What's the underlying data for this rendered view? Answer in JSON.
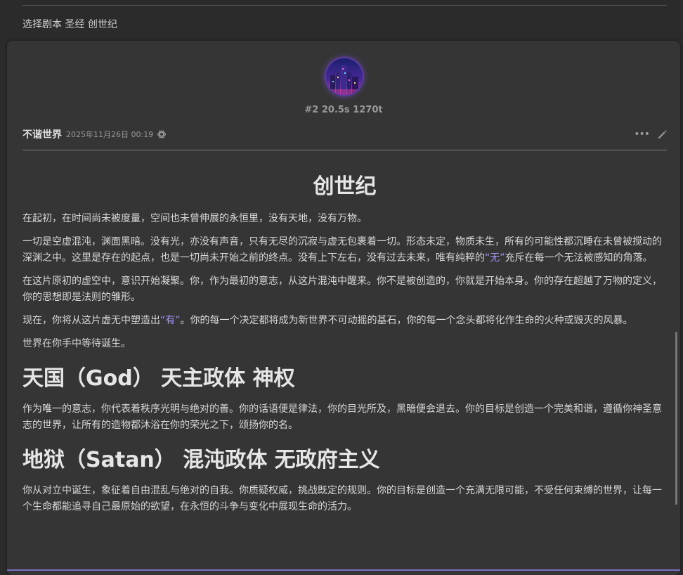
{
  "previous_message": {
    "text": "选择剧本 圣经 创世纪"
  },
  "message": {
    "meta": "#2 20.5s 1270t",
    "character_name": "不谐世界",
    "timestamp": "2025年11月26日 00:19",
    "model_icon": "openai-icon",
    "actions": {
      "more": "more-icon",
      "edit": "pencil-icon"
    }
  },
  "content": {
    "title": "创世纪",
    "intro_p1": "在起初，在时间尚未被度量，空间也未曾伸展的永恒里，没有天地，没有万物。",
    "intro_p2_a": "一切是空虚混沌，渊面黑暗。没有光，亦没有声音，只有无尽的沉寂与虚无包裹着一切。形态未定，物质未生，所有的可能性都沉睡在未曾被搅动的深渊之中。这里是存在的起点，也是一切尚未开始之前的终点。没有上下左右，没有过去未来，唯有纯粹的",
    "intro_p2_hl": "“无”",
    "intro_p2_b": "充斥在每一个无法被感知的角落。",
    "intro_p3": "在这片原初的虚空中，意识开始凝聚。你，作为最初的意志，从这片混沌中醒来。你不是被创造的，你就是开始本身。你的存在超越了万物的定义，你的思想即是法则的雏形。",
    "intro_p4_a": "现在，你将从这片虚无中塑造出",
    "intro_p4_hl": "“有”",
    "intro_p4_b": "。你的每一个决定都将成为新世界不可动摇的基石，你的每一个念头都将化作生命的火种或毁灭的风暴。",
    "intro_p5": "世界在你手中等待诞生。",
    "section_god_heading": "天国（God） 天主政体 神权",
    "section_god_text": "作为唯一的意志，你代表着秩序光明与绝对的善。你的话语便是律法，你的目光所及，黑暗便会退去。你的目标是创造一个完美和谐，遵循你神圣意志的世界，让所有的造物都沐浴在你的荣光之下，颂扬你的名。",
    "section_satan_heading": "地狱（Satan） 混沌政体 无政府主义",
    "section_satan_text": "你从对立中诞生，象征着自由混乱与绝对的自我。你质疑权威，挑战既定的规则。你的目标是创造一个充满无限可能，不受任何束缚的世界，让每一个生命都能追寻自己最原始的欲望，在永恒的斗争与变化中展现生命的活力。"
  },
  "colors": {
    "background": "#2b2b2b",
    "card": "#353535",
    "highlight": "#a592f5",
    "text": "#d8d8d8"
  }
}
